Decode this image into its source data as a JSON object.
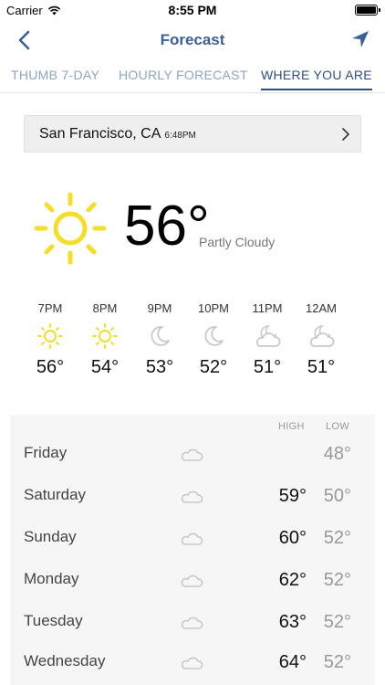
{
  "status": {
    "carrier": "Carrier",
    "time": "8:55 PM"
  },
  "nav": {
    "title": "Forecast"
  },
  "tabs": [
    {
      "label": "THUMB 7-DAY"
    },
    {
      "label": "HOURLY FORECAST"
    },
    {
      "label": "WHERE YOU ARE"
    }
  ],
  "location": {
    "city": "San Francisco, CA",
    "local_time": "6:48PM"
  },
  "current": {
    "temp": "56°",
    "condition": "Partly Cloudy"
  },
  "hourly": [
    {
      "time": "7PM",
      "icon": "sun-icon",
      "temp": "56°"
    },
    {
      "time": "8PM",
      "icon": "sun-icon",
      "temp": "54°"
    },
    {
      "time": "9PM",
      "icon": "moon-icon",
      "temp": "53°"
    },
    {
      "time": "10PM",
      "icon": "moon-icon",
      "temp": "52°"
    },
    {
      "time": "11PM",
      "icon": "moon-cloud-icon",
      "temp": "51°"
    },
    {
      "time": "12AM",
      "icon": "moon-cloud-icon",
      "temp": "51°"
    }
  ],
  "daily": {
    "high_label": "HIGH",
    "low_label": "LOW",
    "days": [
      {
        "day": "Friday",
        "icon": "cloud-icon",
        "high": "",
        "low": "48°"
      },
      {
        "day": "Saturday",
        "icon": "cloud-icon",
        "high": "59°",
        "low": "50°"
      },
      {
        "day": "Sunday",
        "icon": "cloud-icon",
        "high": "60°",
        "low": "52°"
      },
      {
        "day": "Monday",
        "icon": "cloud-icon",
        "high": "62°",
        "low": "52°"
      },
      {
        "day": "Tuesday",
        "icon": "cloud-icon",
        "high": "63°",
        "low": "52°"
      },
      {
        "day": "Wednesday",
        "icon": "cloud-icon",
        "high": "64°",
        "low": "52°"
      }
    ]
  },
  "colors": {
    "nav_blue": "#3a5f99",
    "tab_inactive": "#8da4c4",
    "sun_yellow": "#f5de2a",
    "night_icon_gray": "#c9c9c9"
  }
}
